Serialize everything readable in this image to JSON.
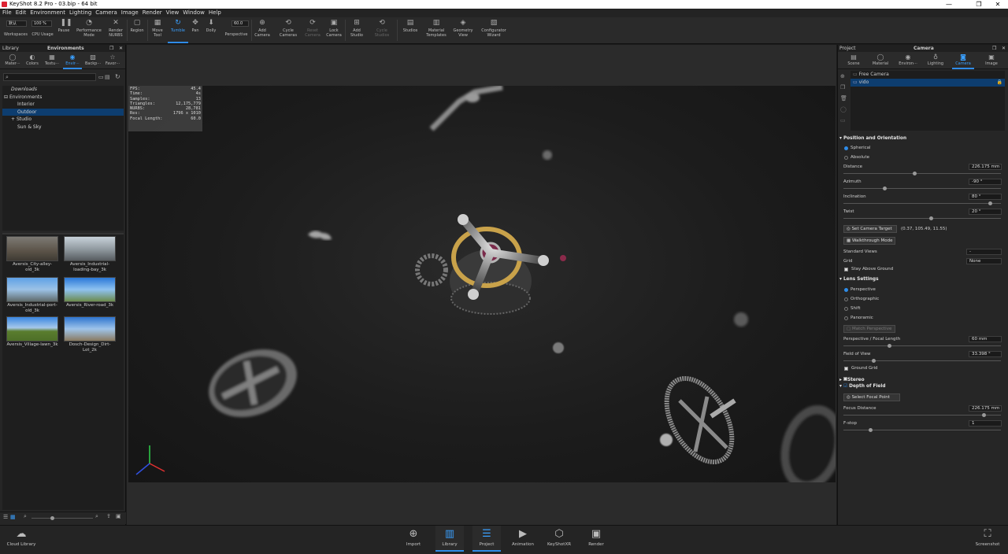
{
  "window": {
    "title": "KeyShot 8.2 Pro  -  03.bip  -  64 bit",
    "min": "—",
    "max": "❐",
    "close": "✕"
  },
  "menu": [
    "File",
    "Edit",
    "Environment",
    "Lighting",
    "Camera",
    "Image",
    "Render",
    "View",
    "Window",
    "Help"
  ],
  "ribbon": {
    "workspace_value": "默认",
    "cpu_value": "100 %",
    "perspective_value": "60.0",
    "items": {
      "workspaces": "Workspaces",
      "cpu": "CPU Usage",
      "pause": "Pause",
      "perf": "Performance Mode",
      "nurbs": "Render NURBS",
      "region": "Region",
      "move": "Move Tool",
      "tumble": "Tumble",
      "pan": "Pan",
      "dolly": "Dolly",
      "perspective": "Perspective",
      "add_camera": "Add Camera",
      "cycle_cameras": "Cycle Cameras",
      "reset_camera": "Reset Camera",
      "lock_camera": "Lock Camera",
      "add_studio": "Add Studio",
      "cycle_studios": "Cycle Studios",
      "studios": "Studios",
      "material_templates": "Material Templates",
      "geometry_view": "Geometry View",
      "configurator_wizard": "Configurator Wizard"
    }
  },
  "library": {
    "header": "Library",
    "section": "Environments",
    "tabs": [
      "Mater···",
      "Colors",
      "Textu···",
      "Envir···",
      "Backp···",
      "Favor···"
    ],
    "tree": [
      "Downloads",
      "Environments",
      "Interior",
      "Outdoor",
      "Studio",
      "Sun & Sky"
    ],
    "thumbs": [
      {
        "label": "Aversis_City-alley-old_3k"
      },
      {
        "label": "Aversis_Industrial-loading-bay_3k"
      },
      {
        "label": "Aversis_Industrial-port-old_3k"
      },
      {
        "label": "Aversis_River-road_3k"
      },
      {
        "label": "Aversis_Village-lawn_3k"
      },
      {
        "label": "Dosch-Design_Dirt-Lot_2k"
      }
    ]
  },
  "stats": [
    {
      "k": "FPS:",
      "v": "45.4"
    },
    {
      "k": "Time:",
      "v": "4s"
    },
    {
      "k": "Samples:",
      "v": "13"
    },
    {
      "k": "Triangles:",
      "v": "12,175,779"
    },
    {
      "k": "NURBS:",
      "v": "28,781"
    },
    {
      "k": "Res:",
      "v": "1796 x 1010"
    },
    {
      "k": "Focal Length:",
      "v": "60.0"
    }
  ],
  "project": {
    "header": "Project",
    "section": "Camera",
    "tabs": [
      "Scene",
      "Material",
      "Environ···",
      "Lighting",
      "Camera",
      "Image"
    ],
    "cameras": [
      "Free Camera",
      "vido"
    ],
    "pos_section": "Position and Orientation",
    "spherical": "Spherical",
    "absolute": "Absolute",
    "distance_label": "Distance",
    "distance_value": "226.175 mm",
    "azimuth_label": "Azimuth",
    "azimuth_value": "-90 °",
    "inclination_label": "Inclination",
    "inclination_value": "80 °",
    "twist_label": "Twist",
    "twist_value": "20 °",
    "set_target": "Set Camera Target",
    "target_coords": "(0.37, 105.49, 11.55)",
    "walkthrough": "Walkthrough Mode",
    "standard_views": "Standard Views",
    "standard_views_value": "-",
    "grid": "Grid",
    "grid_value": "None",
    "stay_above": "Stay Above Ground",
    "lens_section": "Lens Settings",
    "perspective": "Perspective",
    "orthographic": "Orthographic",
    "shift": "Shift",
    "panoramic": "Panoramic",
    "match_perspective": "Match Perspective",
    "focal_label": "Perspective / Focal Length",
    "focal_value": "60 mm",
    "fov_label": "Field of View",
    "fov_value": "33.398 °",
    "ground_grid": "Ground Grid",
    "stereo": "Stereo",
    "dof": "Depth of Field",
    "select_focal": "Select Focal Point",
    "focus_distance_label": "Focus Distance",
    "focus_distance_value": "226.175 mm",
    "fstop_label": "F-stop",
    "fstop_value": "1"
  },
  "bottom": {
    "cloud": "Cloud Library",
    "tabs": [
      "Import",
      "Library",
      "Project",
      "Animation",
      "KeyShotXR",
      "Render"
    ],
    "screenshot": "Screenshot"
  },
  "colors": {
    "accent": "#2f8ce8",
    "selection": "#0d3d6f",
    "gold": "#c9a24a"
  }
}
